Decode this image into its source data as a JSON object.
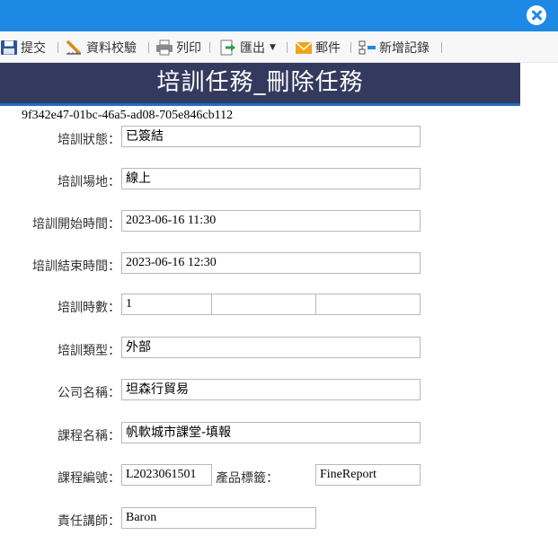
{
  "window": {
    "close_icon": "close-circle-icon",
    "colors": {
      "titlebar": "#1e88e5",
      "header_band": "#343a5e",
      "header_underline": "#1e6fc0"
    }
  },
  "toolbar": {
    "submit": "提交",
    "validate": "資料校驗",
    "print": "列印",
    "export": "匯出",
    "email": "郵件",
    "add_record": "新增記錄"
  },
  "header": {
    "title": "培訓任務_刪除任務"
  },
  "record_id": "9f342e47-01bc-46a5-ad08-705e846cb112",
  "form": {
    "status": {
      "label": "培訓狀態：",
      "value": "已簽結"
    },
    "venue": {
      "label": "培訓場地：",
      "value": "線上"
    },
    "start_time": {
      "label": "培訓開始時間：",
      "value": "2023-06-16 11:30"
    },
    "end_time": {
      "label": "培訓結束時間：",
      "value": "2023-06-16 12:30"
    },
    "hours": {
      "label": "培訓時數：",
      "value": "1",
      "extra1": "",
      "extra2": ""
    },
    "type": {
      "label": "培訓類型：",
      "value": "外部"
    },
    "company": {
      "label": "公司名稱：",
      "value": "坦森行貿易"
    },
    "course_name": {
      "label": "課程名稱：",
      "value": "帆軟城市課堂-填報"
    },
    "course_code": {
      "label": "課程編號：",
      "value": "L2023061501"
    },
    "product_tag": {
      "label": "產品標籤：",
      "value": "FineReport"
    },
    "instructor": {
      "label": "責任講師：",
      "value": "Baron"
    }
  }
}
